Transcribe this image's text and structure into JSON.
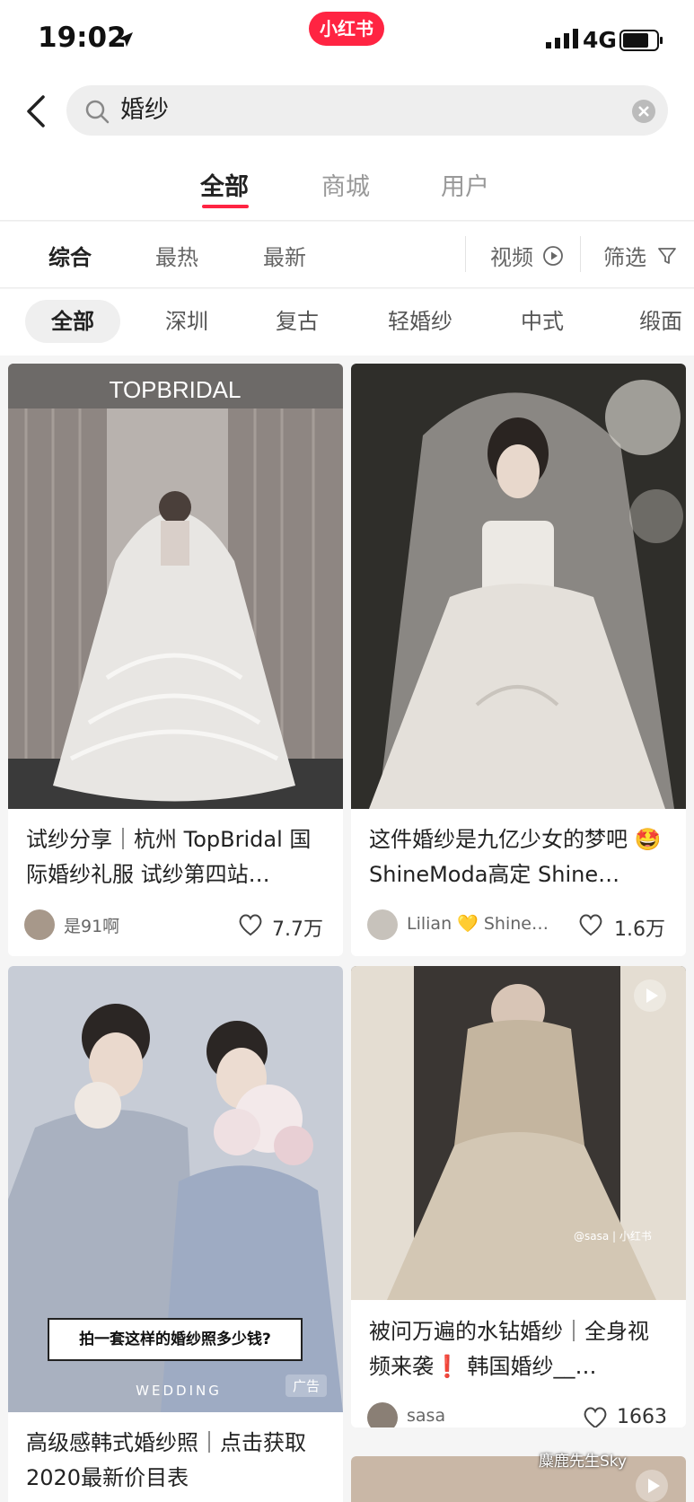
{
  "status": {
    "time": "19:02",
    "network": "4G",
    "app_badge": "小红书"
  },
  "search": {
    "query": "婚纱"
  },
  "main_tabs": [
    {
      "label": "全部",
      "active": true
    },
    {
      "label": "商城",
      "active": false
    },
    {
      "label": "用户",
      "active": false
    }
  ],
  "sort": [
    {
      "label": "综合",
      "active": true
    },
    {
      "label": "最热",
      "active": false
    },
    {
      "label": "最新",
      "active": false
    }
  ],
  "sort_right": {
    "video": "视频",
    "filter": "筛选"
  },
  "chips": [
    "全部",
    "深圳",
    "复古",
    "轻婚纱",
    "中式",
    "缎面"
  ],
  "cards": [
    {
      "image_text": "TOPBRIDAL",
      "title": "试纱分享｜杭州 TopBridal 国际婚纱礼服 试纱第四站…",
      "author": "是91啊",
      "likes": "7.7万"
    },
    {
      "title": "这件婚纱是九亿少女的梦吧 🤩 ShineModa高定 Shine…",
      "author": "Lilian 💛 Shine…",
      "likes": "1.6万"
    },
    {
      "overlay_text": "拍一套这样的婚纱照多少钱?",
      "wedding_text": "WEDDING",
      "ad_label": "广告",
      "title": "高级感韩式婚纱照｜点击获取2020最新价目表"
    },
    {
      "watermark": "@sasa | 小红书",
      "title": "被问万遍的水钻婚纱｜全身视频来袭❗ 韩国婚纱__…",
      "author": "sasa",
      "likes": "1663"
    }
  ],
  "footer_watermark": "麋鹿先生Sky",
  "colors": {
    "brand": "#ff2442",
    "bg": "#f5f5f5"
  }
}
